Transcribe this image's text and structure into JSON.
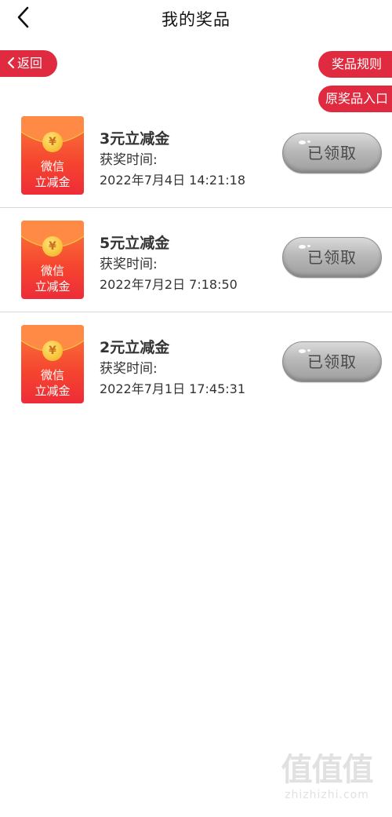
{
  "header": {
    "title": "我的奖品",
    "back_icon": "chevron-left-icon"
  },
  "actions": {
    "return_label": "返回",
    "rules_label": "奖品规则",
    "origin_label": "原奖品入口"
  },
  "envelope": {
    "coin_symbol": "¥",
    "line1": "微信",
    "line2": "立减金"
  },
  "prizes": [
    {
      "name": "3元立减金",
      "time_label": "获奖时间:",
      "time": "2022年7月4日 14:21:18",
      "status": "已领取"
    },
    {
      "name": "5元立减金",
      "time_label": "获奖时间:",
      "time": "2022年7月2日 7:18:50",
      "status": "已领取"
    },
    {
      "name": "2元立减金",
      "time_label": "获奖时间:",
      "time": "2022年7月1日 17:45:31",
      "status": "已领取"
    }
  ],
  "watermark": {
    "glyphs": "值值值",
    "url": "zhizhizhi.com"
  },
  "colors": {
    "accent_red": "#e02a3f",
    "envelope_orange": "#f5442f",
    "claimed_gray": "#b8b8b8"
  }
}
